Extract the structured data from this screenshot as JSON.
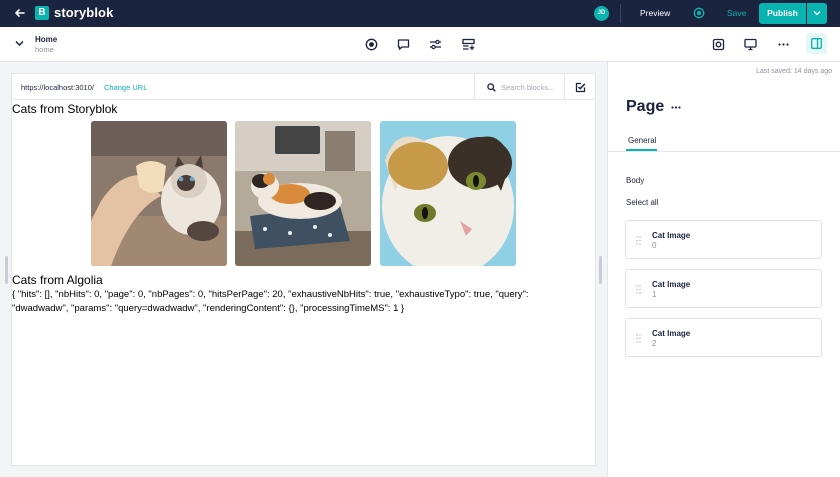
{
  "app": {
    "brand": "storyblok",
    "logo_letter": "B",
    "user_initials": "JD",
    "preview_label": "Preview",
    "save_label": "Save",
    "publish_label": "Publish",
    "accent": "#09b3af",
    "nav_bg": "#1b243f"
  },
  "toolbar": {
    "story_title": "Home",
    "story_slug": "home",
    "icons": [
      "target-icon",
      "comment-icon",
      "sliders-icon",
      "blocks-add-icon"
    ],
    "right_icons": [
      "device-icon",
      "monitor-icon",
      "more-icon",
      "layout-panel-icon"
    ]
  },
  "preview": {
    "url": "https://localhost:3010/",
    "change_url": "Change URL",
    "search_placeholder": "Search blocks...",
    "heading_storyblok": "Cats from Storyblok",
    "heading_algolia": "Cats from Algolia",
    "json_line1": "{ \"hits\": [], \"nbHits\": 0, \"page\": 0, \"nbPages\": 0, \"hitsPerPage\": 20, \"exhaustiveNbHits\": true, \"exhaustiveTypo\": true, \"query\":",
    "json_line2": "\"dwadwadw\", \"params\": \"query=dwadwadw\", \"renderingContent\": {}, \"processingTimeMS\": 1 }"
  },
  "panel": {
    "last_saved": "Last saved: 14 days ago",
    "title": "Page",
    "tab": "General",
    "body_label": "Body",
    "select_all": "Select all",
    "blocks": [
      {
        "title": "Cat Image",
        "index": "0"
      },
      {
        "title": "Cat Image",
        "index": "1"
      },
      {
        "title": "Cat Image",
        "index": "2"
      }
    ]
  }
}
